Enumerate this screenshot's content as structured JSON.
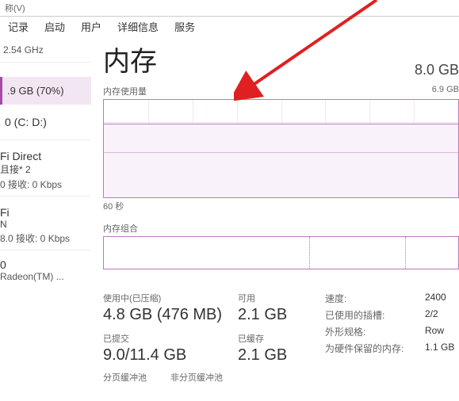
{
  "top_fragment": "称(V)",
  "tabs": [
    "记录",
    "启动",
    "用户",
    "详细信息",
    "服务"
  ],
  "left": {
    "cpu_ghz": "2.54 GHz",
    "mem_usage": ".9 GB (70%)",
    "disk": "0 (C: D:)",
    "wifi1_title": "Fi Direct",
    "wifi1_sub": "且接* 2",
    "wifi1_rx": "0 接收: 0 Kbps",
    "wifi2_title": "Fi",
    "wifi2_sub": "N",
    "wifi2_rx": "8.0 接收: 0 Kbps",
    "gpu_title": "0",
    "gpu_sub": "Radeon(TM) ..."
  },
  "main": {
    "heading": "内存",
    "total": "8.0 GB",
    "usage_label": "内存使用量",
    "usage_max": "6.9 GB",
    "axis_60": "60 秒",
    "compo_label": "内存组合",
    "stats": {
      "in_use_label": "使用中(已压缩)",
      "in_use_val": "4.8 GB (476 MB)",
      "avail_label": "可用",
      "avail_val": "2.1 GB",
      "committed_label": "已提交",
      "committed_val": "9.0/11.4 GB",
      "cached_label": "已缓存",
      "cached_val": "2.1 GB",
      "paged_label": "分页缓冲池",
      "nonpaged_label": "非分页缓冲池"
    },
    "hw": {
      "speed_k": "速度:",
      "speed_v": "2400",
      "slots_k": "已使用的插槽:",
      "slots_v": "2/2",
      "form_k": "外形规格:",
      "form_v": "Row",
      "reserved_k": "为硬件保留的内存:",
      "reserved_v": "1.1 GB"
    }
  },
  "chart_data": {
    "type": "area",
    "title": "内存使用量",
    "ylabel": "GB",
    "ylim": [
      0,
      6.9
    ],
    "x_span_seconds": 60,
    "series": [
      {
        "name": "使用中",
        "approx_value_gb": 4.8
      },
      {
        "name": "已压缩",
        "approx_value_gb": 0.47
      }
    ],
    "note": "flat line across 60s window; in-use ≈4.8 GB of 6.9 GB"
  }
}
